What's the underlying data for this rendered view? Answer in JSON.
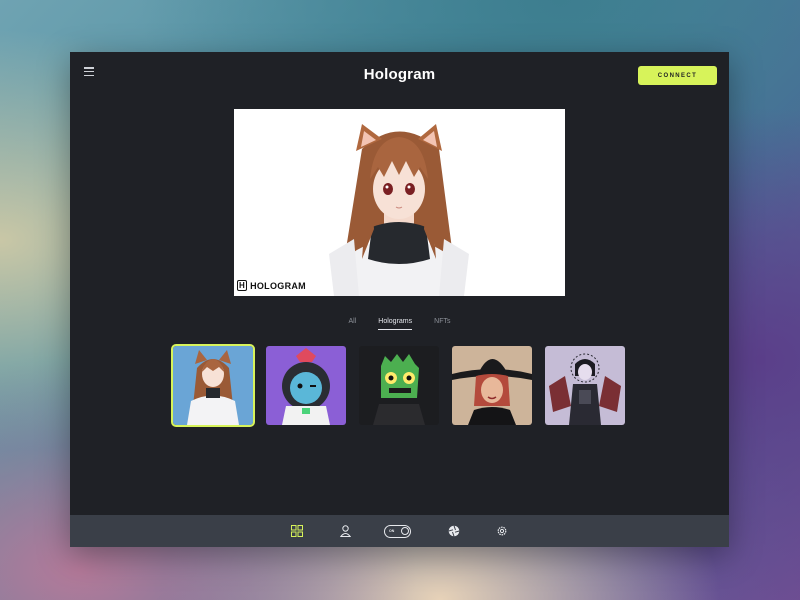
{
  "header": {
    "title": "Hologram",
    "connect_label": "CONNECT"
  },
  "preview": {
    "logo_mark": "H",
    "logo_text": "HOLOGRAM"
  },
  "tabs": [
    {
      "label": "All",
      "active": false
    },
    {
      "label": "Holograms",
      "active": true
    },
    {
      "label": "NFTs",
      "active": false
    }
  ],
  "gallery": [
    {
      "name": "anime-catgirl-avatar",
      "selected": true
    },
    {
      "name": "helmet-cat-avatar",
      "selected": false
    },
    {
      "name": "green-zombie-avatar",
      "selected": false
    },
    {
      "name": "witch-avatar",
      "selected": false
    },
    {
      "name": "dark-winged-avatar",
      "selected": false
    }
  ],
  "bottombar": {
    "toggle_label": "ON",
    "icons": [
      "grid-icon",
      "user-icon",
      "power-toggle",
      "aperture-icon",
      "settings-icon"
    ]
  },
  "colors": {
    "accent": "#d7f35a",
    "window_bg": "#1f2126",
    "bar_bg": "#3a3f48"
  }
}
